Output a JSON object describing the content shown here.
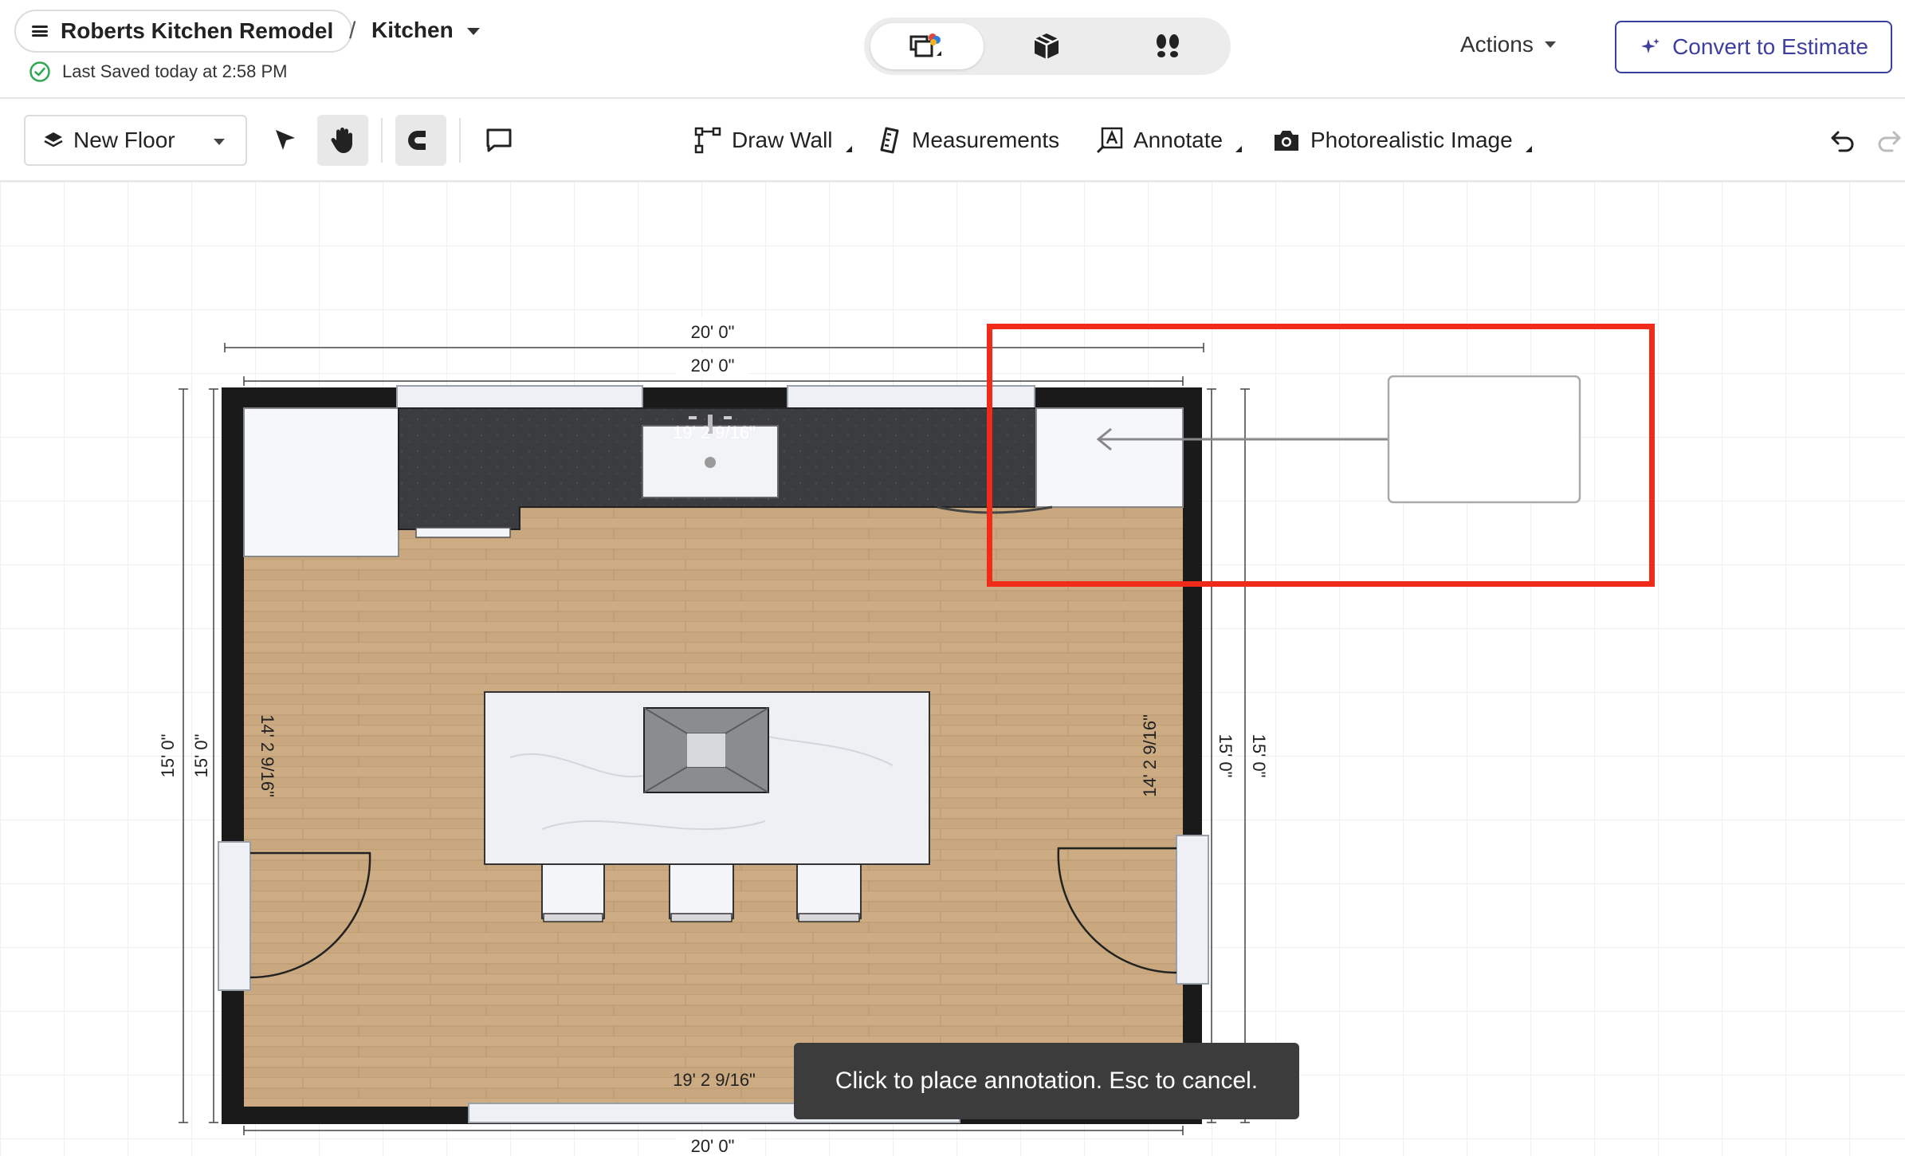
{
  "header": {
    "project_name": "Roberts Kitchen Remodel",
    "breadcrumb_sep": "/",
    "room_name": "Kitchen",
    "save_status": "Last Saved today at 2:58 PM",
    "actions_label": "Actions",
    "convert_label": "Convert to Estimate",
    "view_modes": [
      {
        "name": "2d-floorplan",
        "active": true
      },
      {
        "name": "3d-view",
        "active": false
      },
      {
        "name": "walkthrough",
        "active": false
      }
    ]
  },
  "toolbar": {
    "floor_label": "New Floor",
    "draw_wall_label": "Draw Wall",
    "measurements_label": "Measurements",
    "annotate_label": "Annotate",
    "photo_label": "Photorealistic Image"
  },
  "floorplan": {
    "dim_top_outer": "20' 0\"",
    "dim_top_inner": "20' 0\"",
    "dim_counter": "19' 2 9/16\"",
    "dim_bottom_inner": "19' 2 9/16\"",
    "dim_bottom_outer": "20' 0\"",
    "dim_left_outer": "15' 0\"",
    "dim_left_inner": "15' 0\"",
    "dim_left_room": "14' 2 9/16\"",
    "dim_right_room": "14' 2 9/16\"",
    "dim_right_inner": "15' 0\"",
    "dim_right_outer": "15' 0\""
  },
  "toast": {
    "message": "Click to place annotation. Esc to cancel."
  },
  "colors": {
    "accent": "#3d3f9e",
    "highlight": "#f02b1a",
    "wall": "#1a1a1a",
    "floor": "#c8a77e",
    "countertop": "#3a3b3e",
    "toast_bg": "#3c3c3c"
  }
}
